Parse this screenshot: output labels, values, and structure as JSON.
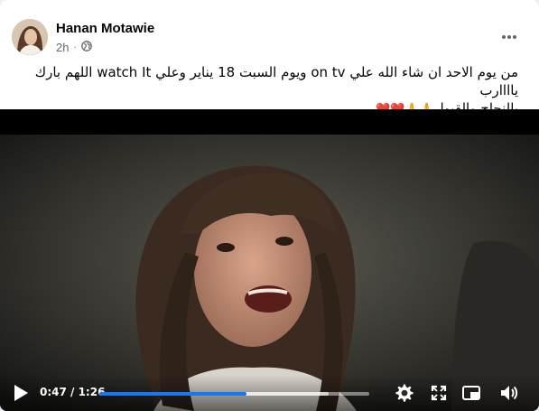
{
  "post": {
    "author": "Hanan Motawie",
    "time": "2h",
    "audience_icon": "globe-icon",
    "caption_line1": "من يوم الاحد ان شاء الله علي on tv ويوم السبت 18 يناير وعلي watch It اللهم بارك ياااارب",
    "caption_line2": "بالنجاح والقبول",
    "caption_emojis": "🙏🙏❤️❤️"
  },
  "video": {
    "current_time": "0:47",
    "duration": "1:26",
    "time_display": "0:47 / 1:26",
    "progress_fraction": 0.546,
    "buffered_fraction": 0.85
  },
  "colors": {
    "progress_played": "#1877f2",
    "author_text": "#050505",
    "meta_text": "#65676b"
  }
}
